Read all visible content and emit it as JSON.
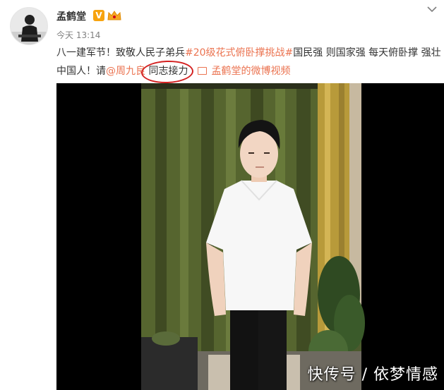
{
  "post": {
    "username": "孟鹤堂",
    "verified_badge": "V",
    "timestamp": "今天 13:14",
    "text_part1": "八一建军节！致敬人民子弟兵",
    "hashtag": "#20级花式俯卧撑挑战#",
    "text_part2": "国民强 则国家强 每天俯卧撑 强壮中国人！请",
    "mention": "@周九良",
    "text_part3": " 同志接力",
    "video_link": "孟鹤堂的微博视频"
  },
  "icons": {
    "avatar": "user-avatar",
    "crown": "crown-icon",
    "more": "chevron-down-icon",
    "video": "video-icon"
  },
  "colors": {
    "link": "#eb7350",
    "badge": "#f7a30f",
    "annotation_circle": "#d32020",
    "video_background": "#000000"
  },
  "video": {
    "watermark": "快传号 / 依梦情感"
  }
}
